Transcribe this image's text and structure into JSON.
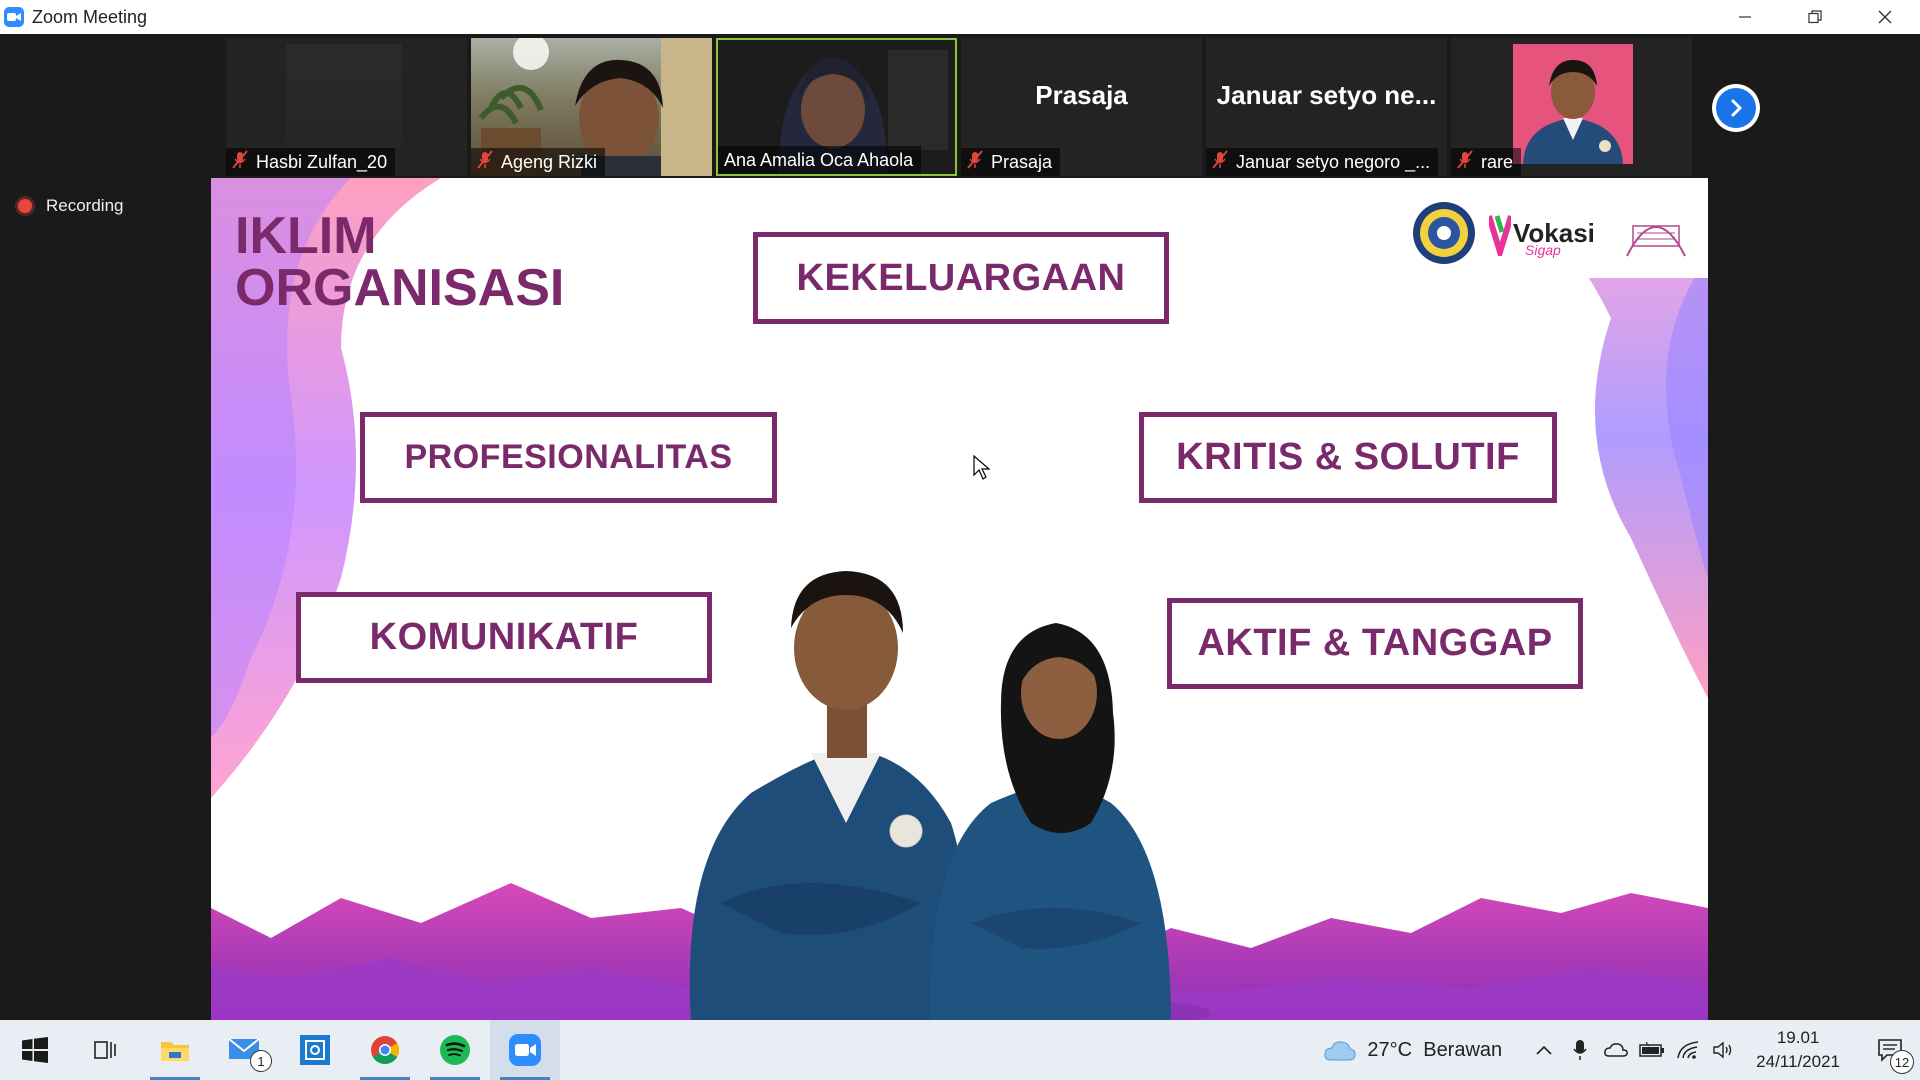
{
  "window": {
    "title": "Zoom Meeting"
  },
  "participants": [
    {
      "name": "Hasbi Zulfan_20",
      "muted": true,
      "video": "dark"
    },
    {
      "name": "Ageng Rizki",
      "muted": true,
      "video": "photo"
    },
    {
      "name": "Ana Amalia Oca Ahaola",
      "muted": false,
      "video": "photo",
      "active_speaker": true
    },
    {
      "name": "Prasaja",
      "display_name": "Prasaja",
      "muted": true,
      "video": "off"
    },
    {
      "name": "Januar setyo negoro _...",
      "display_name": "Januar setyo ne...",
      "muted": true,
      "video": "off"
    },
    {
      "name": "rare",
      "muted": true,
      "video": "photo"
    }
  ],
  "recording": {
    "label": "Recording"
  },
  "slide": {
    "title_line1": "IKLIM",
    "title_line2": "ORGANISASI",
    "boxes": [
      "KEKELUARGAAN",
      "PROFESIONALITAS",
      "KRITIS & SOLUTIF",
      "KOMUNIKATIF",
      "AKTIF & TANGGAP"
    ],
    "logo_text": "Vokasi",
    "logo_subtext": "Sigap",
    "colors": {
      "primary": "#7a2a6a",
      "accent": "#e8329a"
    }
  },
  "taskbar": {
    "apps": [
      "start-icon",
      "task-view-icon",
      "file-explorer-icon",
      "mail-icon",
      "photos-icon",
      "chrome-icon",
      "spotify-icon",
      "zoom-icon"
    ],
    "mail_badge": "1",
    "weather": "27°C  Berawan",
    "time": "19.01",
    "date": "24/11/2021",
    "notification_count": "12"
  }
}
